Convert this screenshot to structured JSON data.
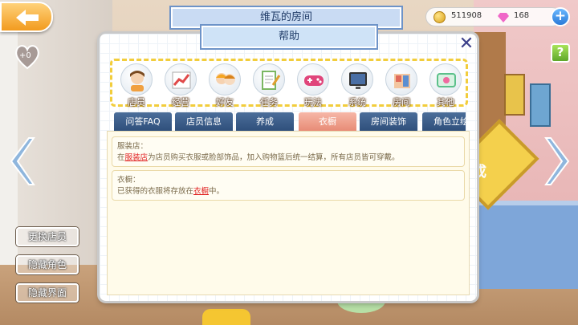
{
  "room_title": "维瓦的房间",
  "currency": {
    "coins": "511908",
    "gems": "168"
  },
  "heart_label": "+0",
  "help_label": "?",
  "plus_label": "+",
  "side_buttons": [
    "更换店员",
    "隐藏角色",
    "隐藏界面"
  ],
  "sign_text": "成",
  "panel": {
    "title": "帮助",
    "close_label": "✕",
    "categories": [
      {
        "label": "店员",
        "icon": "clerk-icon",
        "color": "#f0a040"
      },
      {
        "label": "经营",
        "icon": "chart-icon",
        "color": "#e04a4a"
      },
      {
        "label": "好友",
        "icon": "friends-icon",
        "color": "#f5a623"
      },
      {
        "label": "任务",
        "icon": "task-icon",
        "color": "#7bb661"
      },
      {
        "label": "玩法",
        "icon": "gamepad-icon",
        "color": "#e0457b"
      },
      {
        "label": "系统",
        "icon": "tv-icon",
        "color": "#3a3a3a"
      },
      {
        "label": "房间",
        "icon": "room-icon",
        "color": "#e06a5a"
      },
      {
        "label": "其他",
        "icon": "other-icon",
        "color": "#5cc08a"
      }
    ],
    "tabs": [
      "问答FAQ",
      "店员信息",
      "养成",
      "衣橱",
      "房间装饰",
      "角色立绘"
    ],
    "active_tab": 3,
    "entries": [
      {
        "title": "服装店：",
        "text_before": "在",
        "link": "服装店",
        "text_after": "为店员购买衣服或脸部饰品，加入购物篮后统一结算，所有店员皆可穿戴。"
      },
      {
        "title": "衣橱：",
        "text_before": "已获得的衣服将存放在",
        "link": "衣橱",
        "text_after": "中。"
      }
    ]
  }
}
